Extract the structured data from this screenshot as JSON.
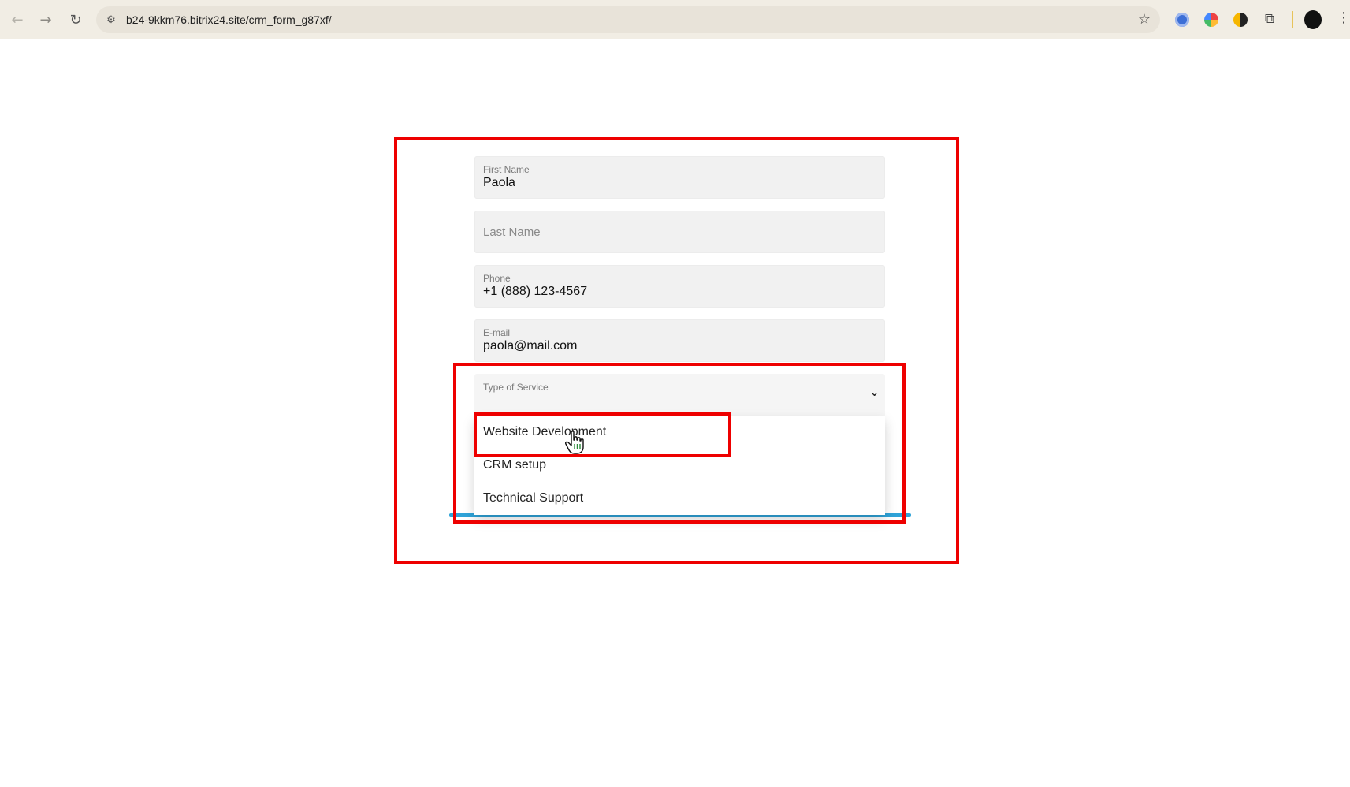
{
  "browser": {
    "url": "b24-9kkm76.bitrix24.site/crm_form_g87xf/",
    "icons": {
      "back": "back-arrow-icon",
      "forward": "forward-arrow-icon",
      "reload": "reload-icon",
      "site_info": "tune-icon",
      "bookmark": "star-icon",
      "menu": "more-vert-icon"
    }
  },
  "form": {
    "first_name": {
      "label": "First Name",
      "value": "Paola"
    },
    "last_name": {
      "placeholder": "Last Name"
    },
    "phone": {
      "label": "Phone",
      "value": "+1 (888) 123-4567"
    },
    "email": {
      "label": "E-mail",
      "value": "paola@mail.com"
    },
    "service": {
      "label": "Type of Service",
      "options": [
        "Website Development",
        "CRM setup",
        "Technical Support"
      ]
    }
  },
  "colors": {
    "annotation": "#ee0000",
    "field_bg": "#f1f1f1",
    "accent_underline": "#2fa3d8",
    "browser_bar": "#f1ede4"
  }
}
